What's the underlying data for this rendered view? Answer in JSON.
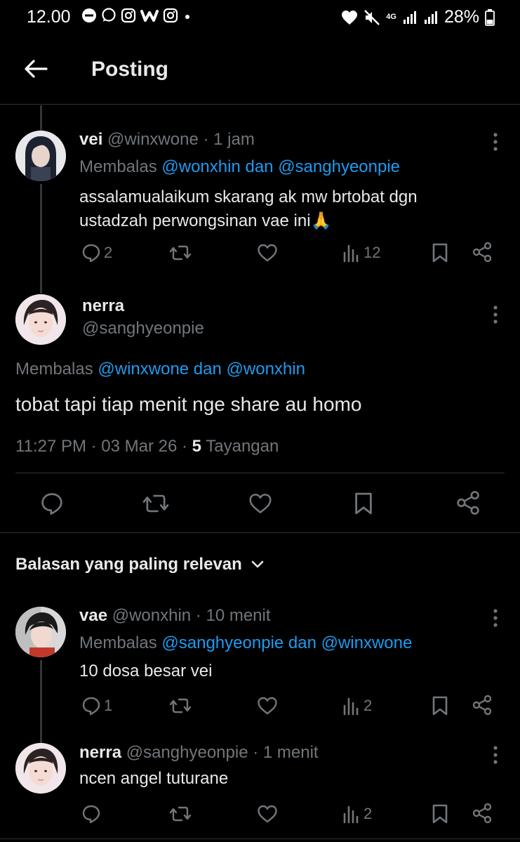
{
  "status_bar": {
    "time": "12.00",
    "network": "4G",
    "battery": "28%"
  },
  "header": {
    "title": "Posting"
  },
  "posts": [
    {
      "display_name": "vei",
      "handle": "@winxwone",
      "time": "· 1 jam",
      "reply_prefix": "Membalas",
      "reply_to": "@wonxhin dan @sanghyeonpie",
      "text_line1": "assalamualaikum skarang ak mw brtobat dgn",
      "text_line2": "ustadzah perwongsinan vae ini🙏",
      "replies": "2",
      "views": "12"
    }
  ],
  "main_post": {
    "display_name": "nerra",
    "handle": "@sanghyeonpie",
    "reply_prefix": "Membalas",
    "reply_to": "@winxwone dan @wonxhin",
    "text": "tobat tapi tiap menit nge share au homo",
    "timestamp": "11:27 PM · 03 Mar 26 ·",
    "views_count": "5",
    "views_label": "Tayangan"
  },
  "sort": {
    "label": "Balasan yang paling relevan"
  },
  "replies": [
    {
      "display_name": "vae",
      "handle": "@wonxhin",
      "time": "· 10 menit",
      "reply_prefix": "Membalas",
      "reply_to": "@sanghyeonpie dan @winxwone",
      "text": "10 dosa besar vei",
      "replies": "1",
      "views": "2"
    },
    {
      "display_name": "nerra",
      "handle": "@sanghyeonpie",
      "time": "· 1 menit",
      "text": "ncen angel tuturane",
      "views": "2"
    }
  ],
  "colors": {
    "background": "#000000",
    "text": "#e7e9ea",
    "muted": "#71767b",
    "link": "#1d9bf0",
    "divider": "#2f3336"
  }
}
